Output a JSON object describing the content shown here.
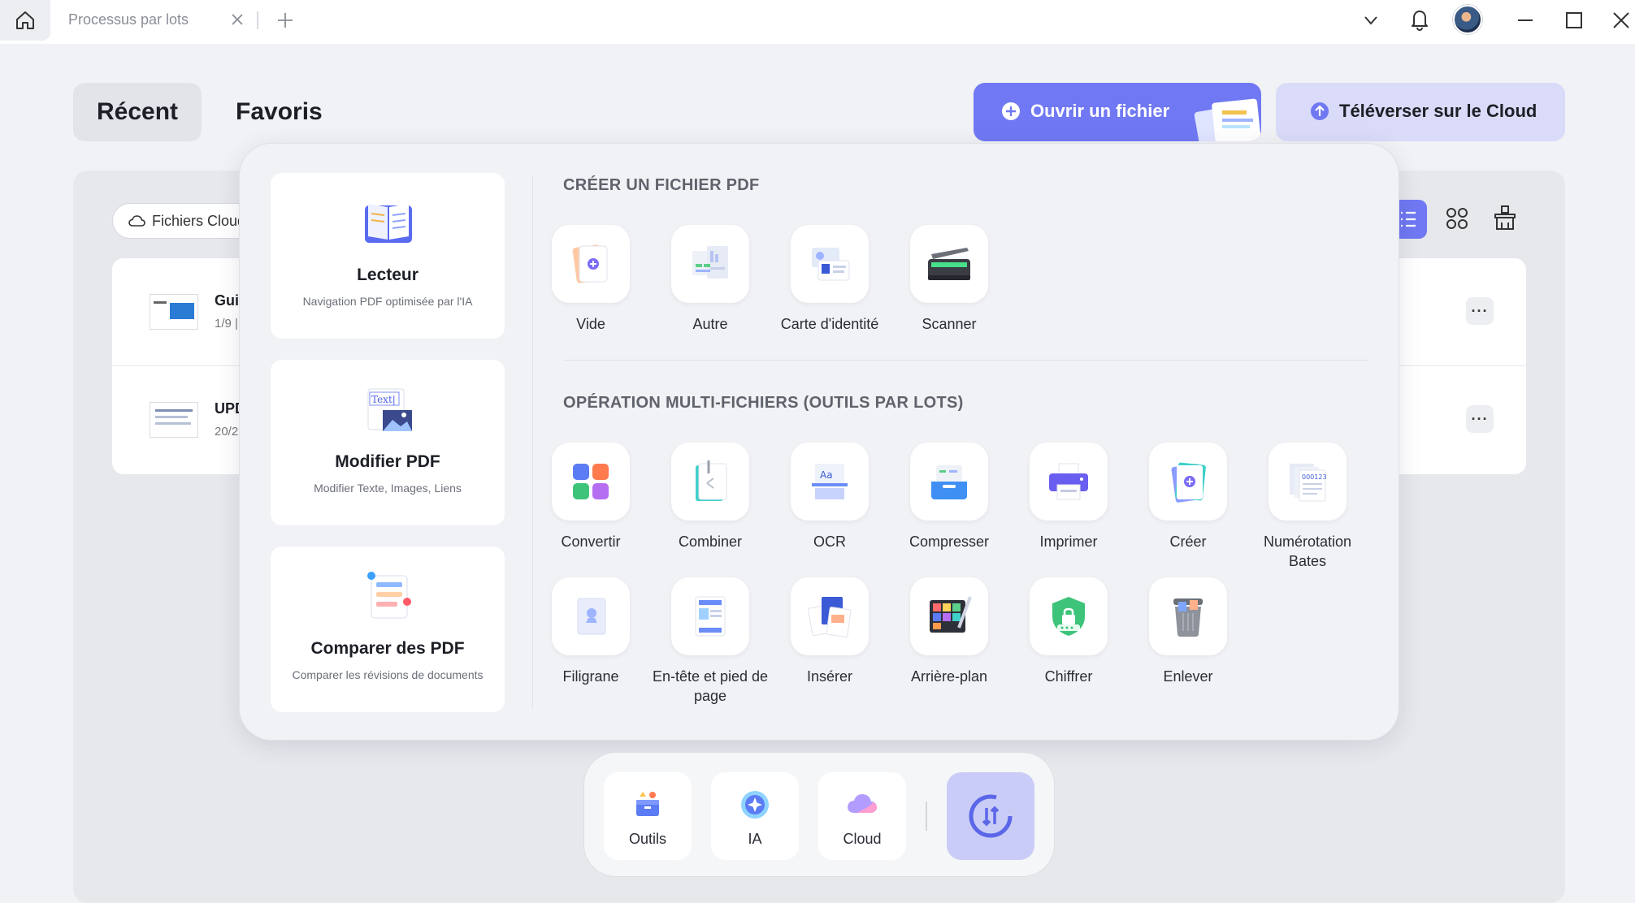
{
  "titlebar": {
    "tab_title": "Processus par lots"
  },
  "header": {
    "recent": "Récent",
    "favorites": "Favoris",
    "open_file": "Ouvrir un fichier",
    "upload_cloud": "Téléverser sur le Cloud"
  },
  "files": {
    "filter_label": "Fichiers Cloud",
    "rows": [
      {
        "name": "Gui",
        "meta": "1/9 |"
      },
      {
        "name": "UPD",
        "meta": "20/2"
      }
    ]
  },
  "features": [
    {
      "title": "Lecteur",
      "subtitle": "Navigation PDF optimisée par l'IA"
    },
    {
      "title": "Modifier PDF",
      "subtitle": "Modifier Texte, Images, Liens"
    },
    {
      "title": "Comparer des PDF",
      "subtitle": "Comparer les révisions de documents"
    }
  ],
  "create": {
    "title": "CRÉER UN FICHIER PDF",
    "tools": [
      "Vide",
      "Autre",
      "Carte d'identité",
      "Scanner"
    ]
  },
  "batch": {
    "title": "OPÉRATION MULTI-FICHIERS (OUTILS PAR LOTS)",
    "tools": [
      "Convertir",
      "Combiner",
      "OCR",
      "Compresser",
      "Imprimer",
      "Créer",
      "Numérotation Bates",
      "Filigrane",
      "En-tête et pied de page",
      "Insérer",
      "Arrière-plan",
      "Chiffrer",
      "Enlever"
    ]
  },
  "edit_icon_text": "Text|",
  "dock": {
    "tools": "Outils",
    "ai": "IA",
    "cloud": "Cloud"
  },
  "colors": {
    "accent": "#7078f3",
    "accent_light": "#d9dbf8"
  }
}
